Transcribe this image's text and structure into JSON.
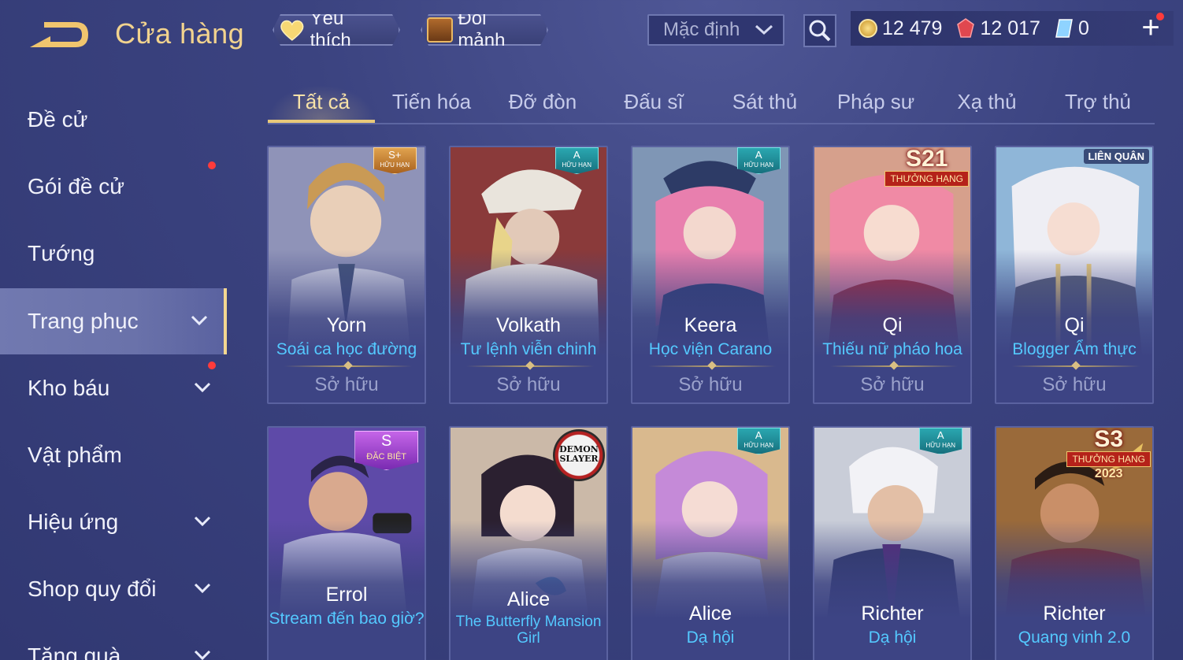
{
  "header": {
    "title": "Cửa hàng",
    "favorites_label": "Yêu thích",
    "shard_exchange_label": "Đổi mảnh",
    "sort_value": "Mặc định",
    "currencies": [
      {
        "icon": "coin-icon",
        "amount": "12 479"
      },
      {
        "icon": "gem-icon",
        "amount": "12 017"
      },
      {
        "icon": "voucher-icon",
        "amount": "0"
      }
    ]
  },
  "sidebar": {
    "items": [
      {
        "label": "Đề cử"
      },
      {
        "label": "Gói đề cử"
      },
      {
        "label": "Tướng"
      },
      {
        "label": "Trang phục"
      },
      {
        "label": "Kho báu"
      },
      {
        "label": "Vật phẩm"
      },
      {
        "label": "Hiệu ứng"
      },
      {
        "label": "Shop quy đổi"
      },
      {
        "label": "Tặng quà"
      }
    ],
    "active_label": "Trang phục"
  },
  "tabs": [
    "Tất cả",
    "Tiến hóa",
    "Đỡ đòn",
    "Đấu sĩ",
    "Sát thủ",
    "Pháp sư",
    "Xạ thủ",
    "Trợ thủ"
  ],
  "cards": [
    {
      "hero": "Yorn",
      "skin": "Soái ca học đường",
      "status": "Sở hữu",
      "badge": "S+",
      "badge_sub": "HỮU HẠN"
    },
    {
      "hero": "Volkath",
      "skin": "Tư lệnh viễn chinh",
      "status": "Sở hữu",
      "badge": "A",
      "badge_sub": "HỮU HẠN"
    },
    {
      "hero": "Keera",
      "skin": "Học viện Carano",
      "status": "Sở hữu",
      "badge": "A",
      "badge_sub": "HỮU HẠN"
    },
    {
      "hero": "Qi",
      "skin": "Thiếu nữ pháo hoa",
      "status": "Sở hữu",
      "badge": "S21",
      "badge_sub": "THƯỞNG HẠNG"
    },
    {
      "hero": "Qi",
      "skin": "Blogger Ẩm thực",
      "status": "Sở hữu",
      "badge": "LIÊN QUÂN"
    },
    {
      "hero": "Errol",
      "skin": "Stream đến bao giờ?",
      "badge": "S",
      "badge_sub": "ĐẶC BIỆT"
    },
    {
      "hero": "Alice",
      "skin": "The Butterfly Mansion Girl",
      "badge": "DEMON SLAYER"
    },
    {
      "hero": "Alice",
      "skin": "Dạ hội",
      "badge": "A",
      "badge_sub": "HỮU HẠN"
    },
    {
      "hero": "Richter",
      "skin": "Dạ hội",
      "badge": "A",
      "badge_sub": "HỮU HẠN"
    },
    {
      "hero": "Richter",
      "skin": "Quang vinh 2.0",
      "badge": "S3",
      "badge_sub": "THƯỞNG HẠNG",
      "badge_year": "2023"
    }
  ],
  "colors": {
    "background": "#3b4380",
    "accent_gold": "#f2d38e",
    "skin_name": "#54c9ff",
    "owned_text": "#9ba2cc",
    "notification": "#ff3b3b"
  }
}
